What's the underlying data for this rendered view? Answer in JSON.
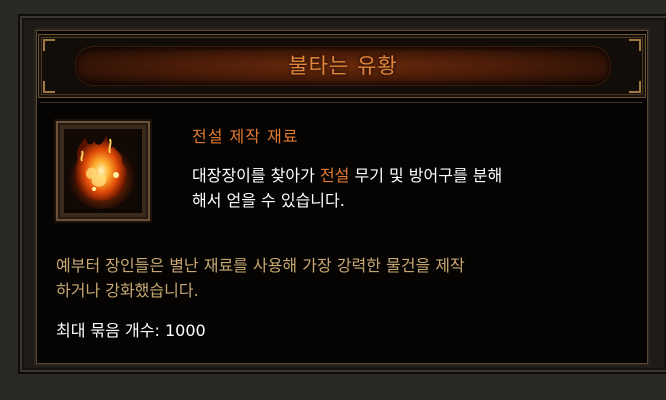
{
  "title": "불타는 유황",
  "item_type": "전설 제작 재료",
  "description": {
    "part1": "대장장이를 찾아가 ",
    "highlight": "전설",
    "part2": " 무기 및 방어구를 분해",
    "line2": "해서 얻을 수 있습니다."
  },
  "lore": {
    "line1": "예부터 장인들은 별난 재료를 사용해 가장 강력한 물건을 제작",
    "line2": "하거나 강화했습니다."
  },
  "stack": {
    "label": "최대 묶음 개수: ",
    "value": "1000"
  },
  "item_icon": "burning-sulfur-icon",
  "colors": {
    "title": "#e0853a",
    "legendary": "#e07a30",
    "lore": "#c8a872",
    "text": "#ffffff"
  }
}
